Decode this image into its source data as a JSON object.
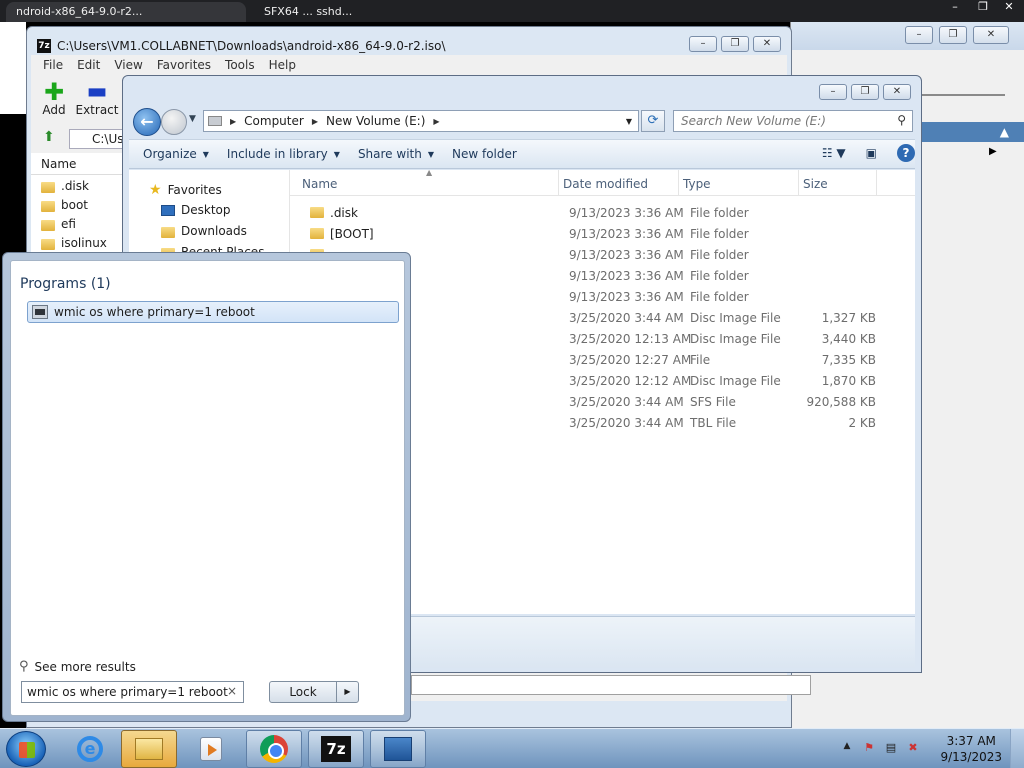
{
  "top_tabs": [
    "ndroid-x86_64-9.0-r2...",
    "SFX64 ... sshd..."
  ],
  "top_controls": [
    "–",
    "❐",
    "✕"
  ],
  "zip": {
    "title": "C:\\Users\\VM1.COLLABNET\\Downloads\\android-x86_64-9.0-r2.iso\\",
    "logo": "7z",
    "menu": [
      "File",
      "Edit",
      "View",
      "Favorites",
      "Tools",
      "Help"
    ],
    "add_label": "Add",
    "extract_label": "Extract",
    "address": "C:\\Use",
    "name_header": "Name",
    "items": [
      ".disk",
      "boot",
      "efi",
      "isolinux"
    ]
  },
  "explorer": {
    "breadcrumb": [
      "Computer",
      "New Volume (E:)"
    ],
    "search_placeholder": "Search New Volume (E:)",
    "commands": [
      "Organize",
      "Include in library",
      "Share with",
      "New folder"
    ],
    "help": "?",
    "nav": {
      "favorites": "Favorites",
      "items": [
        "Desktop",
        "Downloads",
        "Recent Places"
      ]
    },
    "columns": [
      "Name",
      "Date modified",
      "Type",
      "Size"
    ],
    "rows": [
      {
        "name": ".disk",
        "date": "9/13/2023 3:36 AM",
        "type": "File folder",
        "size": ""
      },
      {
        "name": "[BOOT]",
        "date": "9/13/2023 3:36 AM",
        "type": "File folder",
        "size": ""
      },
      {
        "name": "",
        "date": "9/13/2023 3:36 AM",
        "type": "File folder",
        "size": ""
      },
      {
        "name": "",
        "date": "9/13/2023 3:36 AM",
        "type": "File folder",
        "size": ""
      },
      {
        "name": "",
        "date": "9/13/2023 3:36 AM",
        "type": "File folder",
        "size": ""
      },
      {
        "name": "",
        "date": "3/25/2020 3:44 AM",
        "type": "Disc Image File",
        "size": "1,327 KB"
      },
      {
        "name": "",
        "date": "3/25/2020 12:13 AM",
        "type": "Disc Image File",
        "size": "3,440 KB"
      },
      {
        "name": "",
        "date": "3/25/2020 12:27 AM",
        "type": "File",
        "size": "7,335 KB"
      },
      {
        "name": "",
        "date": "3/25/2020 12:12 AM",
        "type": "Disc Image File",
        "size": "1,870 KB"
      },
      {
        "name": "",
        "date": "3/25/2020 3:44 AM",
        "type": "SFS File",
        "size": "920,588 KB"
      },
      {
        "name": "",
        "date": "3/25/2020 3:44 AM",
        "type": "TBL File",
        "size": "2 KB"
      }
    ]
  },
  "start_menu": {
    "programs_heading": "Programs (1)",
    "result": "wmic os where primary=1 reboot",
    "see_more": "See more results",
    "search_value": "wmic os where primary=1 reboot",
    "clear": "×",
    "lock_label": "Lock"
  },
  "taskbar": {
    "clock_time": "3:37 AM",
    "clock_date": "9/13/2023"
  },
  "colors": {
    "taskbar": "#7a9cc3",
    "selection": "#d3e4f8",
    "active_task": "#f0c36a"
  }
}
